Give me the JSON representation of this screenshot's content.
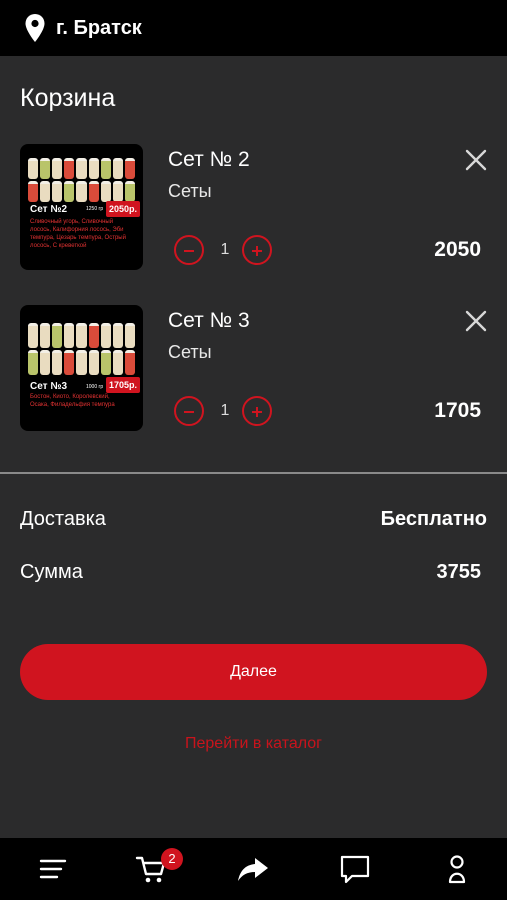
{
  "header": {
    "city": "г. Братск",
    "location_icon": "location-pin-icon"
  },
  "page": {
    "title": "Корзина"
  },
  "cart": {
    "items": [
      {
        "name": "Сет № 2",
        "category": "Сеты",
        "quantity": "1",
        "price": "2050",
        "thumb": {
          "set_name": "Сет №2",
          "weight": "1250 гр",
          "price_tag": "2050р.",
          "description": "Сливочный угорь, Сливочный лосось, Калифорния лосось, Эби темпура, Цезарь темпура, Острый лосось, С креветкой"
        }
      },
      {
        "name": "Сет № 3",
        "category": "Сеты",
        "quantity": "1",
        "price": "1705",
        "thumb": {
          "set_name": "Сет №3",
          "weight": "1000 гр",
          "price_tag": "1705р.",
          "description": "Бостон, Киото, Королевский, Осака, Филадельфия темпура"
        }
      }
    ]
  },
  "summary": {
    "delivery_label": "Доставка",
    "delivery_value": "Бесплатно",
    "sum_label": "Сумма",
    "sum_value": "3755"
  },
  "actions": {
    "next_label": "Далее",
    "catalog_label": "Перейти в каталог"
  },
  "bottom_nav": {
    "cart_badge": "2",
    "items": [
      "menu-icon",
      "cart-icon",
      "share-icon",
      "chat-icon",
      "profile-icon"
    ]
  },
  "colors": {
    "accent": "#d0141f",
    "background": "#2b2b2c",
    "bar": "#000000"
  }
}
